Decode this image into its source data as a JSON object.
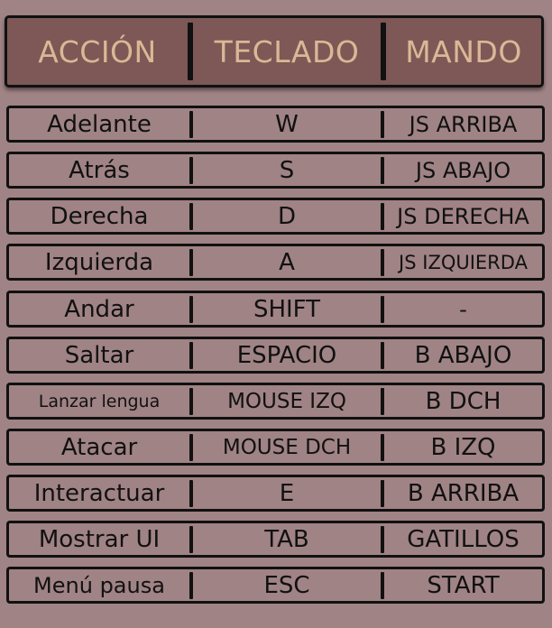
{
  "header": {
    "action": "ACCIÓN",
    "keyboard": "TECLADO",
    "controller": "MANDO"
  },
  "rows": [
    {
      "action": "Adelante",
      "keyboard": "W",
      "controller": "JS ARRIBA"
    },
    {
      "action": "Atrás",
      "keyboard": "S",
      "controller": "JS ABAJO"
    },
    {
      "action": "Derecha",
      "keyboard": "D",
      "controller": "JS DERECHA"
    },
    {
      "action": "Izquierda",
      "keyboard": "A",
      "controller": "JS IZQUIERDA"
    },
    {
      "action": "Andar",
      "keyboard": "SHIFT",
      "controller": "-"
    },
    {
      "action": "Saltar",
      "keyboard": "ESPACIO",
      "controller": "B ABAJO"
    },
    {
      "action": "Lanzar lengua",
      "keyboard": "MOUSE IZQ",
      "controller": "B DCH"
    },
    {
      "action": "Atacar",
      "keyboard": "MOUSE DCH",
      "controller": "B IZQ"
    },
    {
      "action": "Interactuar",
      "keyboard": "E",
      "controller": "B ARRIBA"
    },
    {
      "action": "Mostrar UI",
      "keyboard": "TAB",
      "controller": "GATILLOS"
    },
    {
      "action": "Menú pausa",
      "keyboard": "ESC",
      "controller": "START"
    }
  ]
}
